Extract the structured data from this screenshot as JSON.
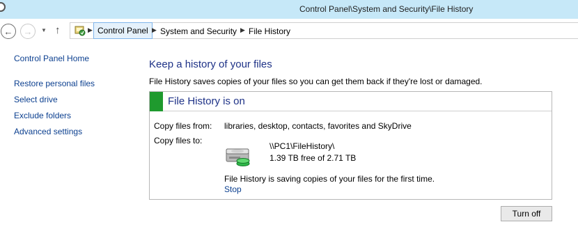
{
  "window": {
    "title": "Control Panel\\System and Security\\File History"
  },
  "toolbar": {
    "back_icon": "back-arrow-icon",
    "forward_icon": "forward-arrow-icon",
    "recent_icon": "dropdown-arrow-icon",
    "up_icon": "up-arrow-icon",
    "breadcrumbs": [
      "Control Panel",
      "System and Security",
      "File History"
    ]
  },
  "sidebar": {
    "items": [
      {
        "label": "Control Panel Home"
      },
      {
        "label": "Restore personal files"
      },
      {
        "label": "Select drive"
      },
      {
        "label": "Exclude folders"
      },
      {
        "label": "Advanced settings"
      }
    ]
  },
  "main": {
    "heading": "Keep a history of your files",
    "description": "File History saves copies of your files so you can get them back if they're lost or damaged.",
    "status": {
      "title": "File History is on",
      "color": "#1f9a2e"
    },
    "copy_from_label": "Copy files from:",
    "copy_from_value": "libraries, desktop, contacts, favorites and SkyDrive",
    "copy_to_label": "Copy files to:",
    "drive": {
      "icon": "hard-drive-icon",
      "path": "\\\\PC1\\FileHistory\\",
      "space": "1.39 TB free of 2.71 TB"
    },
    "saving_text": "File History is saving copies of your files for the first time.",
    "stop_label": "Stop",
    "turn_off_label": "Turn off"
  }
}
